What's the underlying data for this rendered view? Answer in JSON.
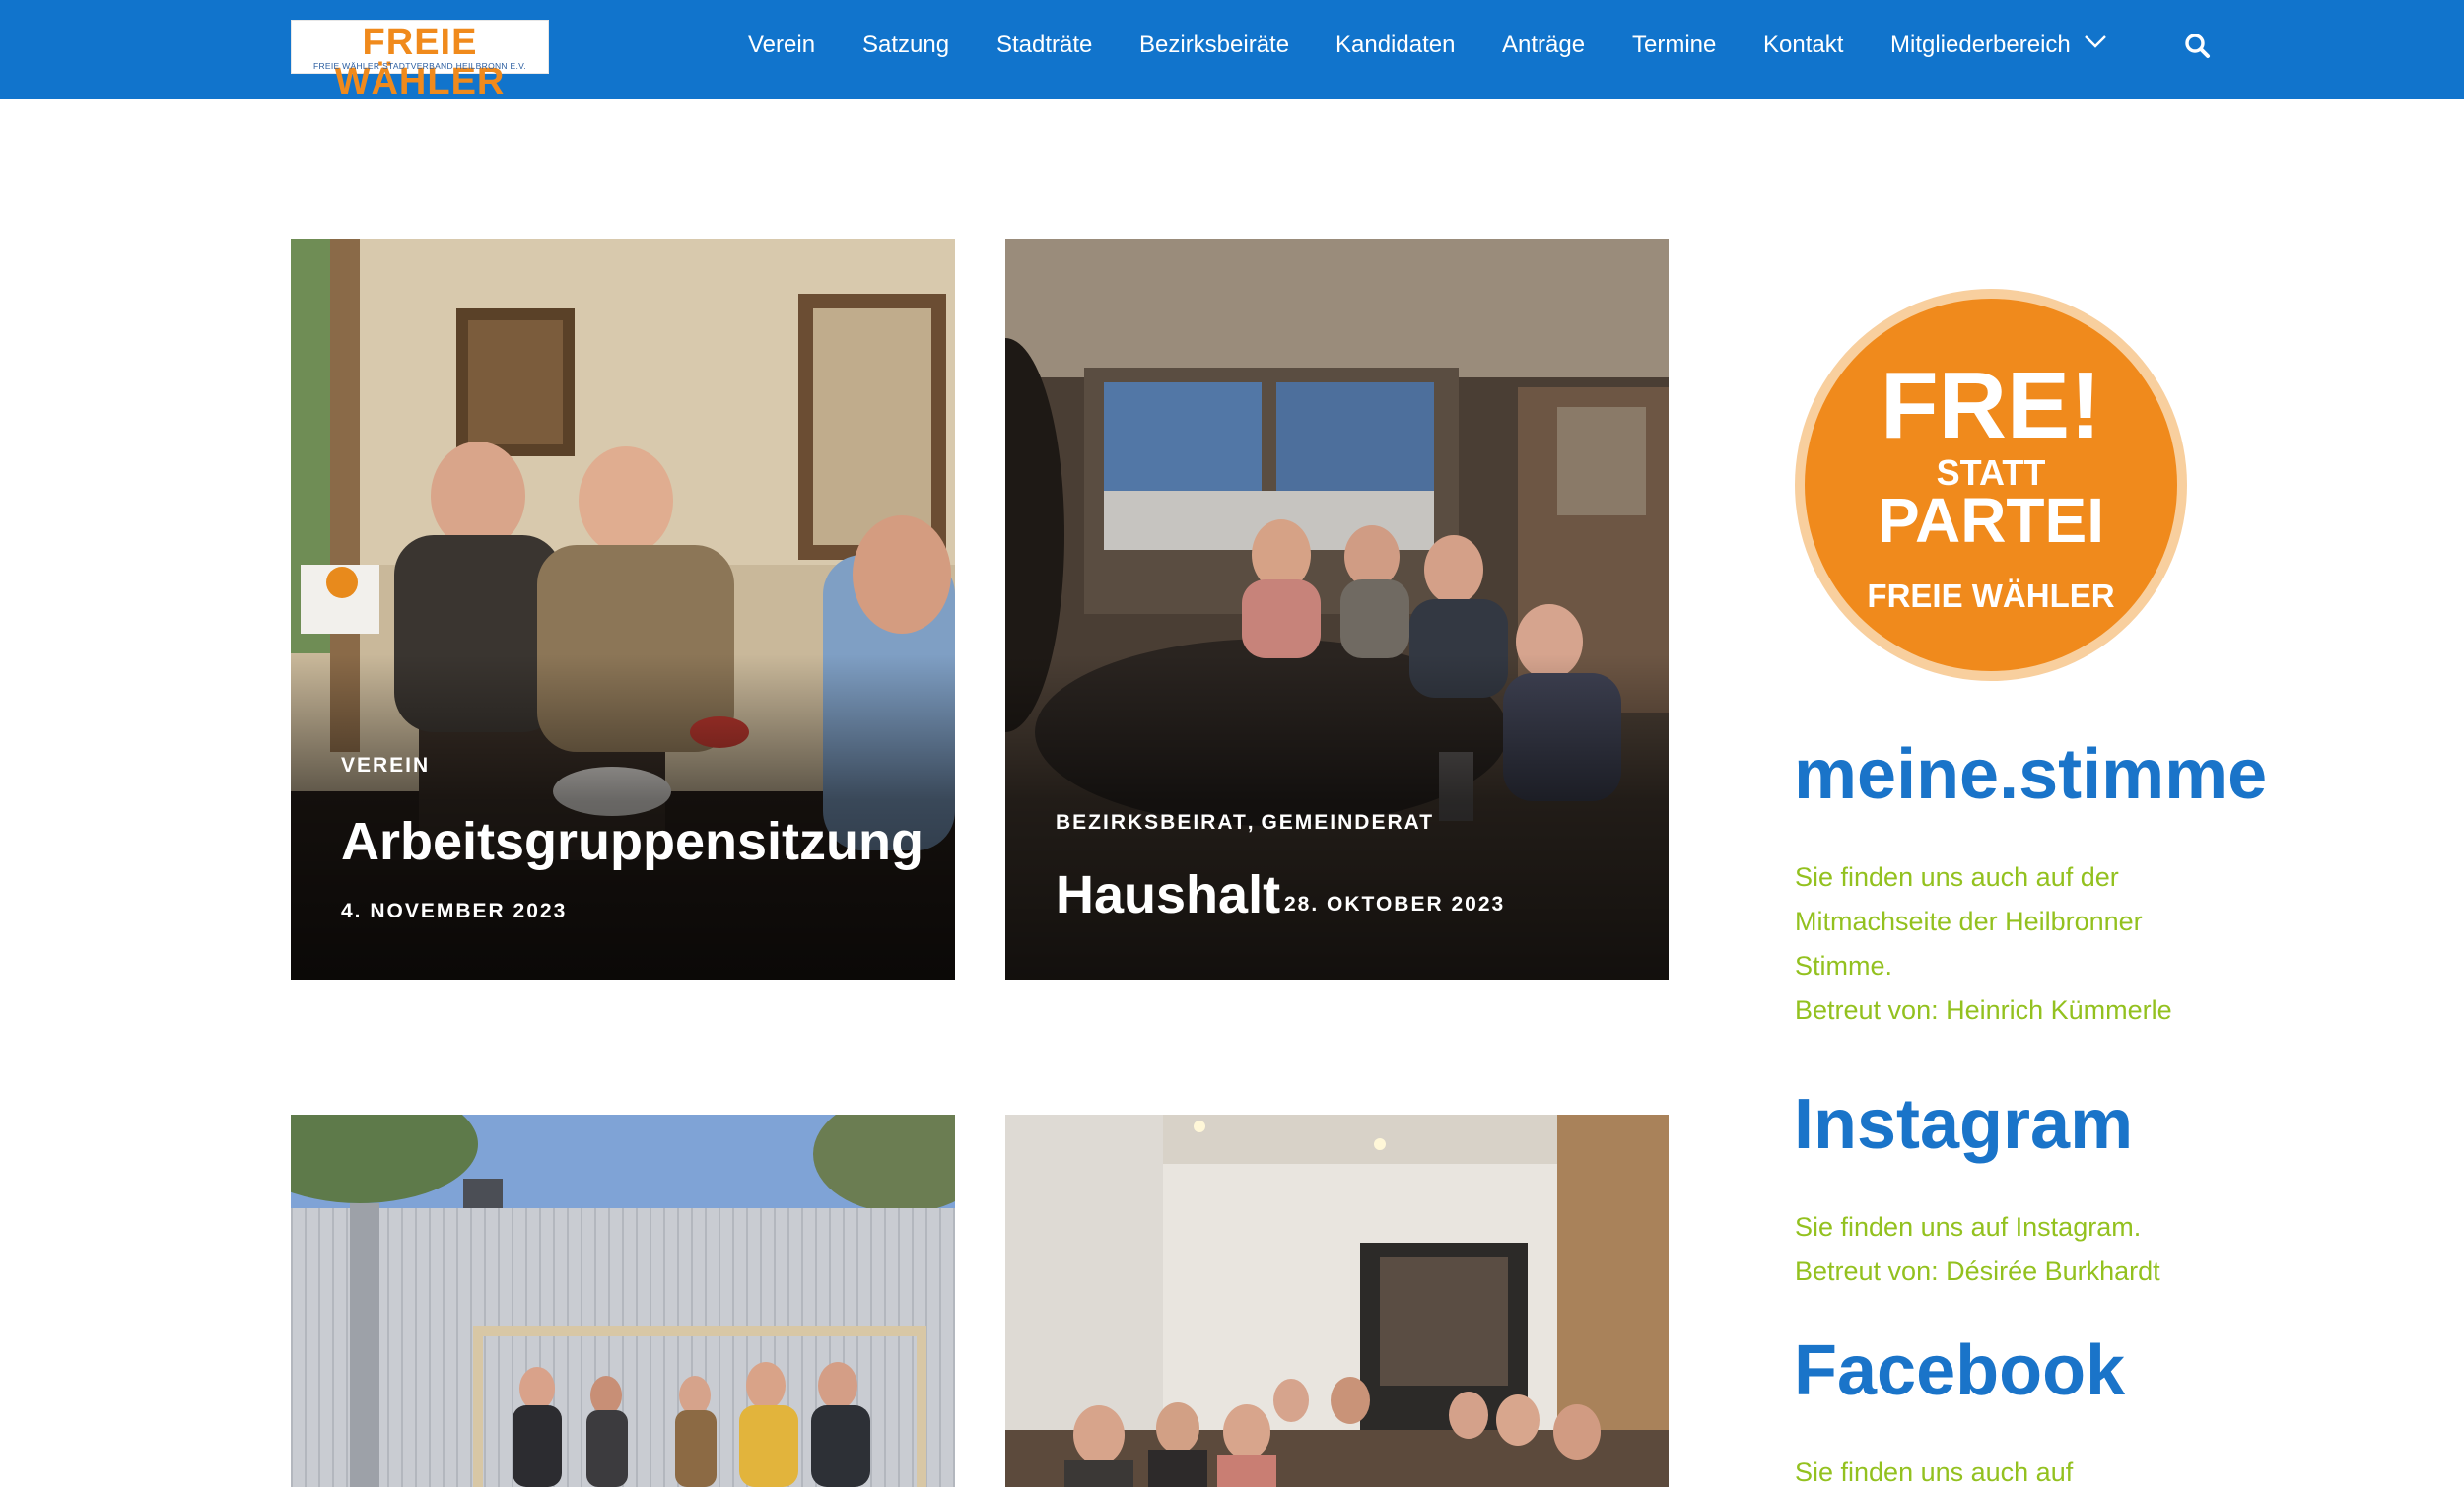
{
  "header": {
    "logo_title": "FREIE WÄHLER",
    "logo_subtitle": "FREIE WÄHLER STADTVERBAND HEILBRONN E.V.",
    "nav": [
      "Verein",
      "Satzung",
      "Stadträte",
      "Bezirksbeiräte",
      "Kandidaten",
      "Anträge",
      "Termine",
      "Kontakt",
      "Mitgliederbereich"
    ],
    "icons": {
      "dropdown": "chevron-down-icon",
      "search": "search-icon"
    }
  },
  "posts": [
    {
      "categories": [
        "Verein"
      ],
      "title": "Arbeitsgruppensitzung",
      "date": "4. November 2023"
    },
    {
      "categories": [
        "Bezirksbeirat",
        "Gemeinderat"
      ],
      "category_separator": ",",
      "title": "Haushalt",
      "date": "28. Oktober 2023"
    },
    {
      "categories": [],
      "title": "",
      "date": ""
    },
    {
      "categories": [],
      "title": "",
      "date": ""
    }
  ],
  "sidebar": {
    "badge": {
      "line1": "FRE!",
      "line2": "STATT",
      "line3": "PARTEI",
      "line4": "FREIE WÄHLER"
    },
    "sections": [
      {
        "heading": "meine.stimme",
        "lines": [
          "Sie finden uns auch auf der",
          "Mitmachseite der Heilbronner",
          "Stimme.",
          "Betreut von: Heinrich Kümmerle"
        ]
      },
      {
        "heading": "Instagram",
        "lines": [
          "Sie finden uns auf Instagram.",
          "Betreut von: Désirée Burkhardt"
        ]
      },
      {
        "heading": "Facebook",
        "lines": [
          "Sie finden uns auch auf"
        ]
      }
    ]
  },
  "colors": {
    "header_bg": "#1174cc",
    "logo_orange": "#f08a1c",
    "heading_blue": "#1a74c9",
    "text_green": "#93c11f",
    "badge_orange": "#f08a1c"
  }
}
